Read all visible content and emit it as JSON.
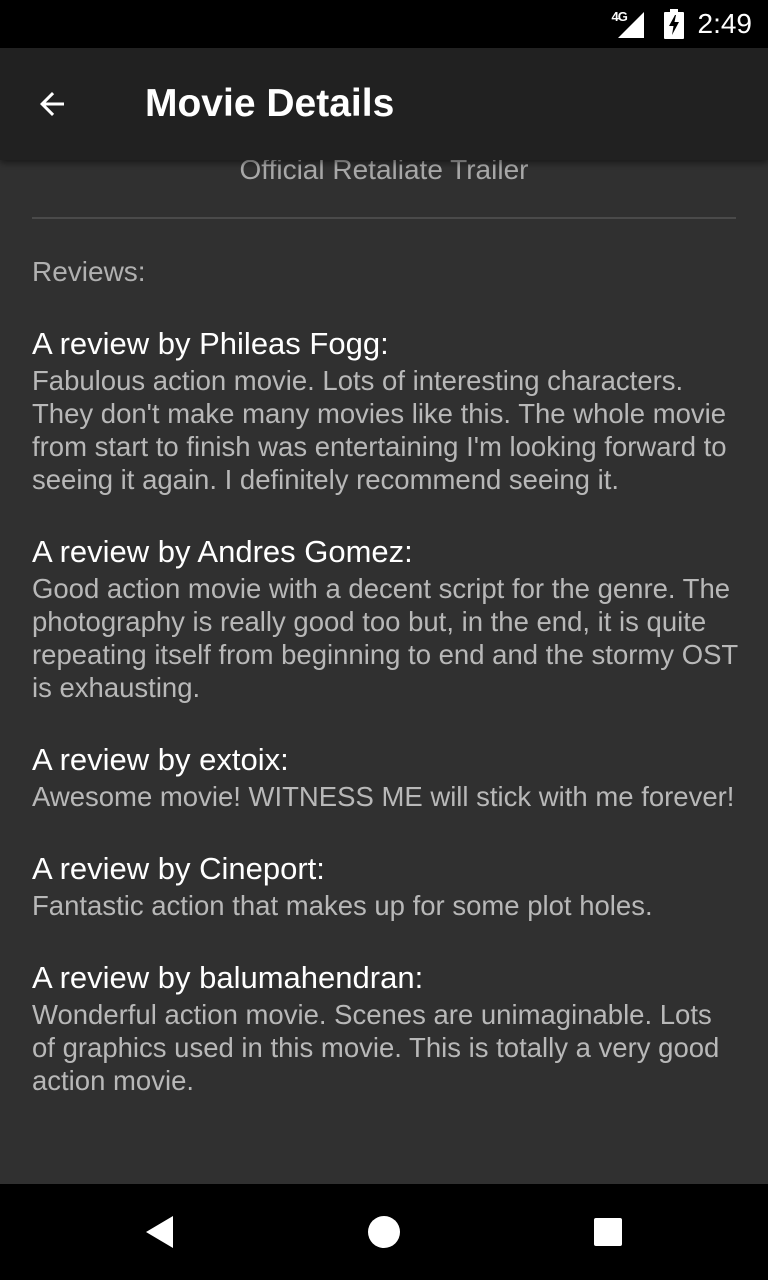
{
  "status_bar": {
    "network_type": "4G",
    "time": "2:49"
  },
  "app_bar": {
    "title": "Movie Details",
    "back_icon": "arrow-back-icon"
  },
  "trailer": {
    "label": "Official Retaliate Trailer"
  },
  "reviews_heading": "Reviews:",
  "reviews": [
    {
      "author": "A review by Phileas Fogg:",
      "body": "Fabulous action movie. Lots of interesting characters. They don't make many movies like this. The whole movie from start to finish was entertaining I'm looking forward to seeing it again. I definitely recommend seeing it."
    },
    {
      "author": "A review by Andres Gomez:",
      "body": "Good action movie with a decent script for the genre. The photography is really good too but, in the end, it is quite repeating itself from beginning to end and the stormy OST is exhausting."
    },
    {
      "author": "A review by extoix:",
      "body": "Awesome movie!  WITNESS ME will stick with me forever!"
    },
    {
      "author": "A review by Cineport:",
      "body": "Fantastic action that makes up for some plot holes."
    },
    {
      "author": "A review by balumahendran:",
      "body": "Wonderful action movie. Scenes are unimaginable. Lots of graphics used in this movie. This is totally a very good action movie."
    }
  ],
  "colors": {
    "status_bar": "#000000",
    "app_bar": "#212121",
    "background": "#303030",
    "title_text": "#ffffff",
    "secondary_text": "#b8b8b8"
  },
  "nav_bar": {
    "icons": [
      "back-triangle-icon",
      "home-circle-icon",
      "recents-square-icon"
    ]
  }
}
